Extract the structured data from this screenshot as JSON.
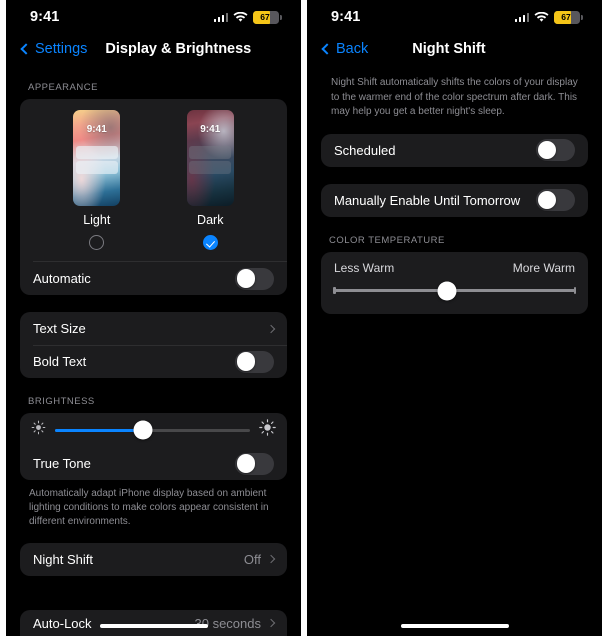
{
  "left_phone": {
    "status_bar": {
      "time": "9:41",
      "battery_pct": "67",
      "signal_icon": "cellular-signal-icon",
      "wifi_icon": "wifi-icon",
      "battery_icon": "battery-icon"
    },
    "nav": {
      "back_label": "Settings",
      "title": "Display & Brightness"
    },
    "appearance": {
      "header": "APPEARANCE",
      "options": [
        {
          "label": "Light",
          "preview_time": "9:41",
          "selected": false
        },
        {
          "label": "Dark",
          "preview_time": "9:41",
          "selected": true
        }
      ],
      "automatic_label": "Automatic",
      "automatic_on": false
    },
    "text_group": {
      "text_size_label": "Text Size",
      "bold_text_label": "Bold Text",
      "bold_text_on": false
    },
    "brightness": {
      "header": "BRIGHTNESS",
      "value_pct": 45,
      "low_icon": "brightness-low-icon",
      "high_icon": "brightness-high-icon",
      "true_tone_label": "True Tone",
      "true_tone_on": false,
      "footnote": "Automatically adapt iPhone display based on ambient lighting conditions to make colors appear consistent in different environments."
    },
    "night_shift_row": {
      "label": "Night Shift",
      "value": "Off"
    },
    "auto_lock_row": {
      "label": "Auto-Lock",
      "value": "30 seconds"
    }
  },
  "right_phone": {
    "status_bar": {
      "time": "9:41",
      "battery_pct": "67",
      "signal_icon": "cellular-signal-icon",
      "wifi_icon": "wifi-icon",
      "battery_icon": "battery-icon"
    },
    "nav": {
      "back_label": "Back",
      "title": "Night Shift"
    },
    "blurb": "Night Shift automatically shifts the colors of your display to the warmer end of the color spectrum after dark. This may help you get a better night's sleep.",
    "scheduled": {
      "label": "Scheduled",
      "on": false
    },
    "manual": {
      "label": "Manually Enable Until Tomorrow",
      "on": false
    },
    "color_temperature": {
      "header": "COLOR TEMPERATURE",
      "left_label": "Less Warm",
      "right_label": "More Warm",
      "value_pct": 47
    }
  },
  "colors": {
    "accent_blue": "#0a84ff",
    "card_bg": "#1c1c1e",
    "page_bg": "#000000",
    "secondary_text": "#8d8d93",
    "battery_yellow": "#f5c518"
  }
}
